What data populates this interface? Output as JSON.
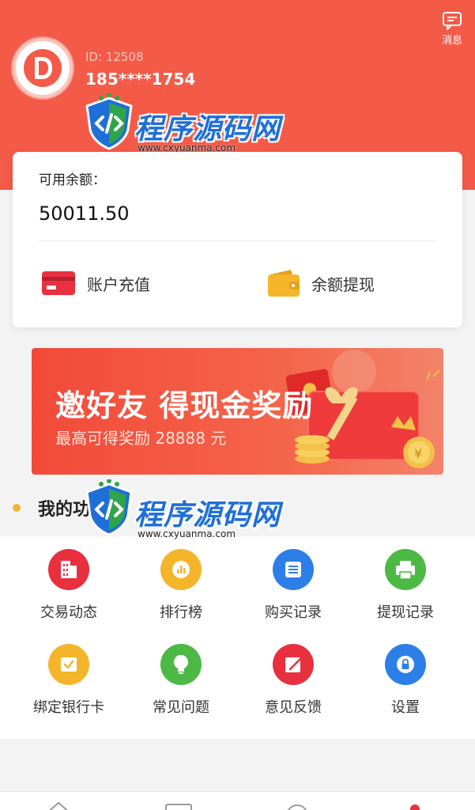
{
  "header": {
    "message_label": "消息",
    "user_id": "ID: 12508",
    "phone": "185****1754"
  },
  "watermark": {
    "title": "程序源码网",
    "subtitle": "www.cxyuanma.com"
  },
  "balance": {
    "label": "可用余额：",
    "value": "50011.50",
    "recharge_label": "账户充值",
    "withdraw_label": "余额提现"
  },
  "banner": {
    "title": "邀好友 得现金奖励",
    "subtitle": "最高可得奖励 28888 元"
  },
  "section": {
    "title": "我的功能"
  },
  "functions": [
    {
      "label": "交易动态",
      "icon": "building-icon",
      "color": "#e8303f"
    },
    {
      "label": "排行榜",
      "icon": "ranking-icon",
      "color": "#f5b52a"
    },
    {
      "label": "购买记录",
      "icon": "list-icon",
      "color": "#2d7fe8"
    },
    {
      "label": "提现记录",
      "icon": "printer-icon",
      "color": "#4cb944"
    },
    {
      "label": "绑定银行卡",
      "icon": "card-check-icon",
      "color": "#f5b52a"
    },
    {
      "label": "常见问题",
      "icon": "bulb-icon",
      "color": "#4cb944"
    },
    {
      "label": "意见反馈",
      "icon": "feedback-icon",
      "color": "#e8303f"
    },
    {
      "label": "设置",
      "icon": "lock-icon",
      "color": "#2d7fe8"
    }
  ],
  "colors": {
    "brand": "#f45a48",
    "accent_gold": "#f5b52a"
  }
}
